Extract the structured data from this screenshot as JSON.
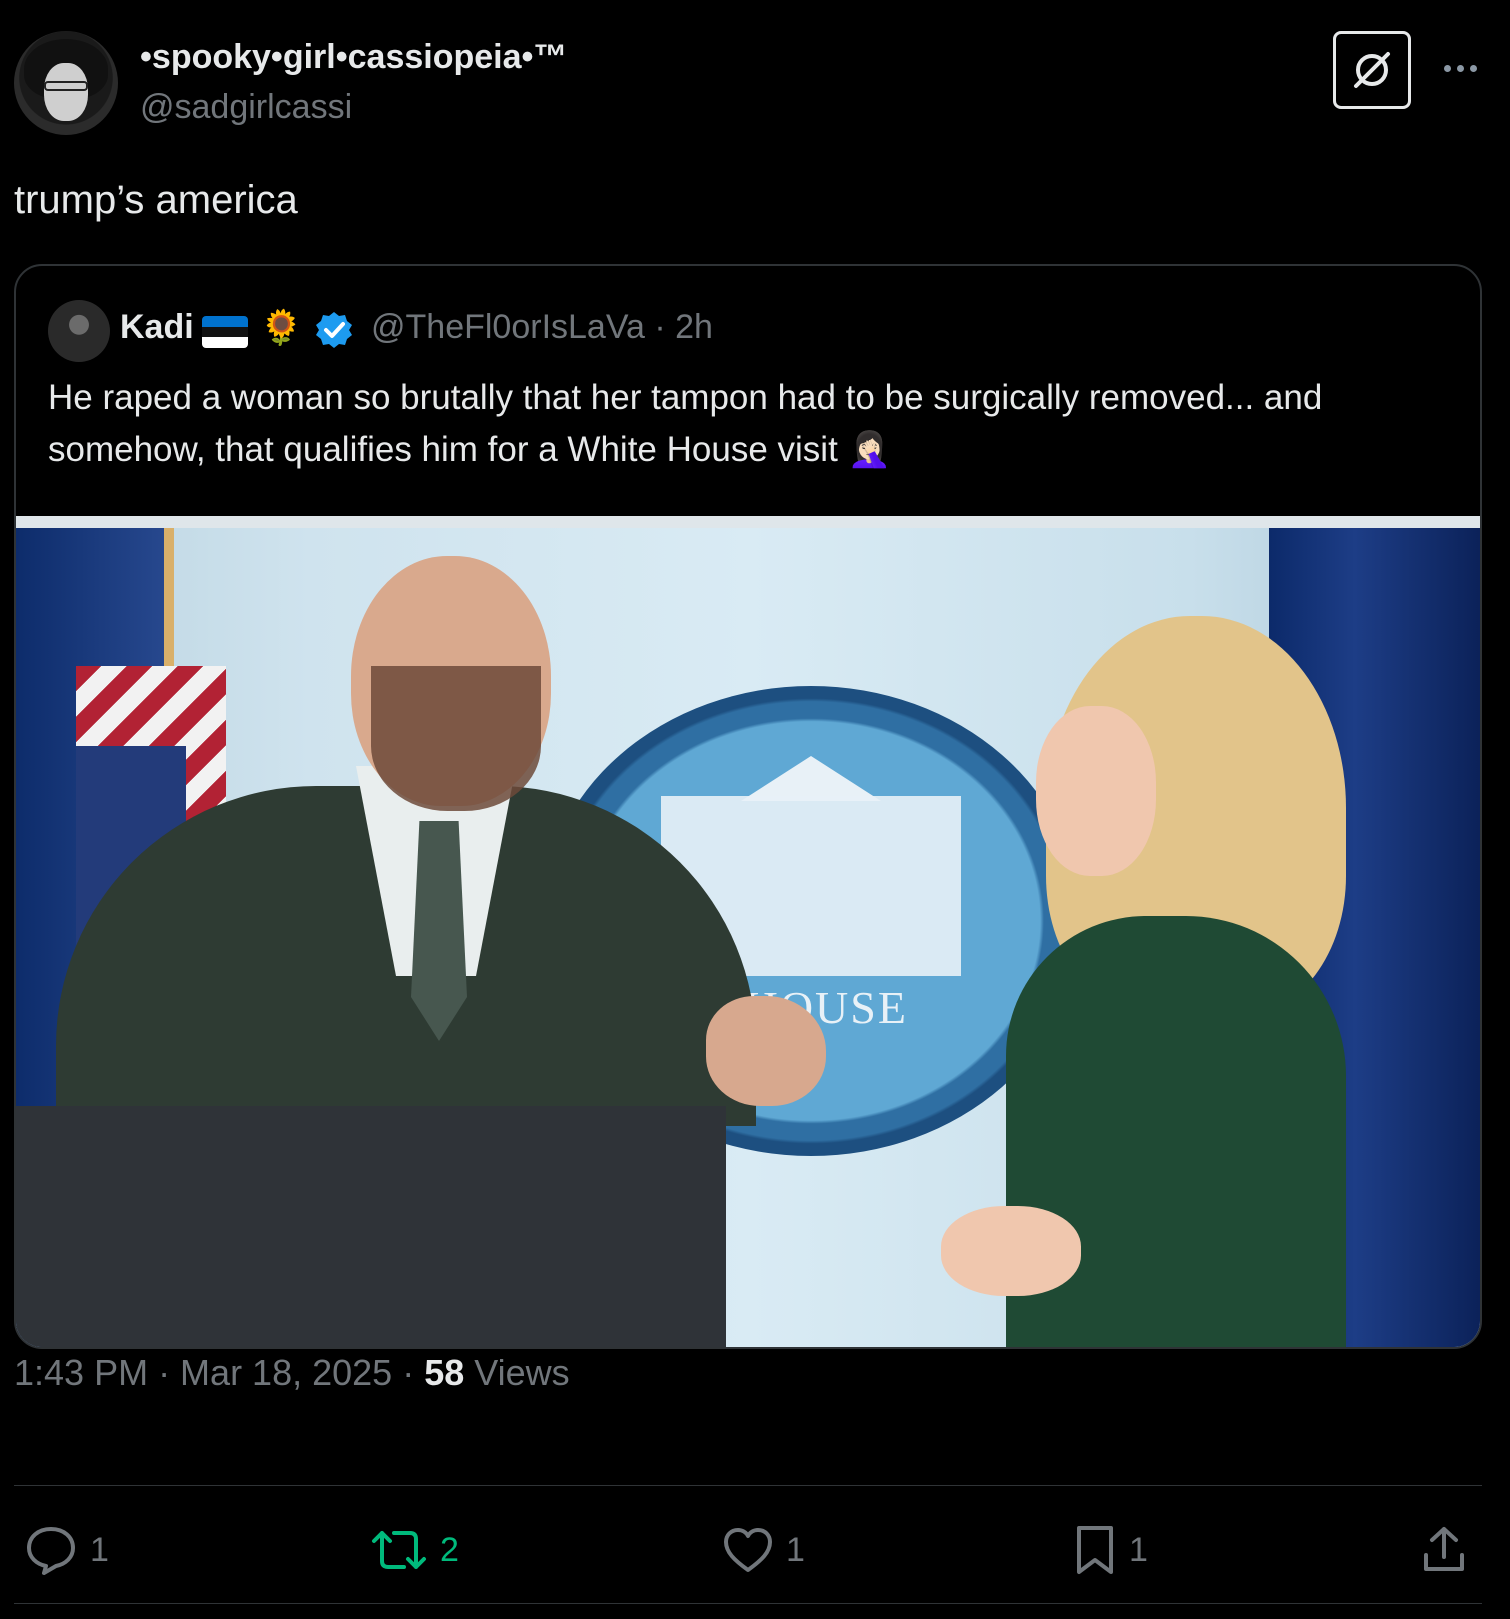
{
  "author": {
    "display_name": "•spooky•girl•cassiopeia•™",
    "handle": "@sadgirlcassi",
    "avatar_icon": "profile-avatar"
  },
  "header_actions": {
    "grok_icon": "grok-icon",
    "more_icon": "more-dots-icon"
  },
  "tweet": {
    "text": "trump’s america"
  },
  "quote": {
    "name": "Kadi",
    "flag_icon": "estonia-flag-icon",
    "sunflower": "🌻",
    "verified_icon": "verified-badge-icon",
    "verified_color": "#1d9bf0",
    "handle_time": "@TheFl0orIsLaVa · 2h",
    "text": "He raped a woman so brutally that her tampon had to be surgically removed... and somehow, that qualifies him for a White House visit 🤦🏻‍♀️",
    "photo": {
      "sign_text": "E HOUSE"
    }
  },
  "meta": {
    "time_date": "1:43 PM · Mar 18, 2025 · ",
    "views_count": "58",
    "views_label": " Views"
  },
  "actions": {
    "replies": "1",
    "reposts": "2",
    "likes": "1",
    "bookmarks": "1",
    "repost_color": "#00ba7c",
    "share_icon": "share-icon"
  }
}
